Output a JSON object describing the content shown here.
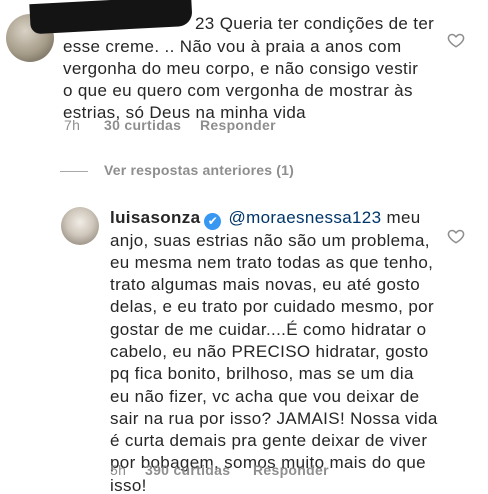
{
  "comment1": {
    "username_visible_suffix": "23",
    "text_line1": "Queria ter condições de ter",
    "text_lines": [
      "esse creme. .. Não vou à praia a anos com",
      "vergonha do meu corpo,  e não consigo vestir",
      "o que eu quero com vergonha de mostrar às",
      "estrias,  só Deus na minha vida"
    ],
    "time": "7h",
    "likes": "30 curtidas",
    "reply_label": "Responder"
  },
  "view_previous_replies": "Ver respostas anteriores (1)",
  "comment2": {
    "username": "luisasonza",
    "verified_icon": "✔",
    "mention": "@moraesnessa123",
    "text_line1_tail": " meu",
    "text_lines": [
      "anjo, suas estrias não são um problema,",
      "eu mesma nem trato todas as que tenho,",
      "trato  algumas mais novas, eu até gosto",
      "delas, e eu trato por cuidado mesmo, por",
      "gostar de me cuidar....É como hidratar o",
      "cabelo, eu não PRECISO hidratar, gosto",
      "pq fica bonito, brilhoso, mas se um dia",
      "eu não fizer, vc acha que vou deixar de",
      "sair na rua por isso? JAMAIS! Nossa vida",
      "é curta demais pra gente deixar de viver",
      "por bobagem, somos muito mais do que",
      "isso!"
    ],
    "time": "5h",
    "likes": "390 curtidas",
    "reply_label": "Responder"
  },
  "colors": {
    "text": "#262626",
    "secondary": "#8e8e8e",
    "verified_blue": "#3897f0",
    "mention_blue": "#003569"
  },
  "icons": {
    "like": "heart-outline-icon",
    "verified": "verified-badge-icon"
  }
}
